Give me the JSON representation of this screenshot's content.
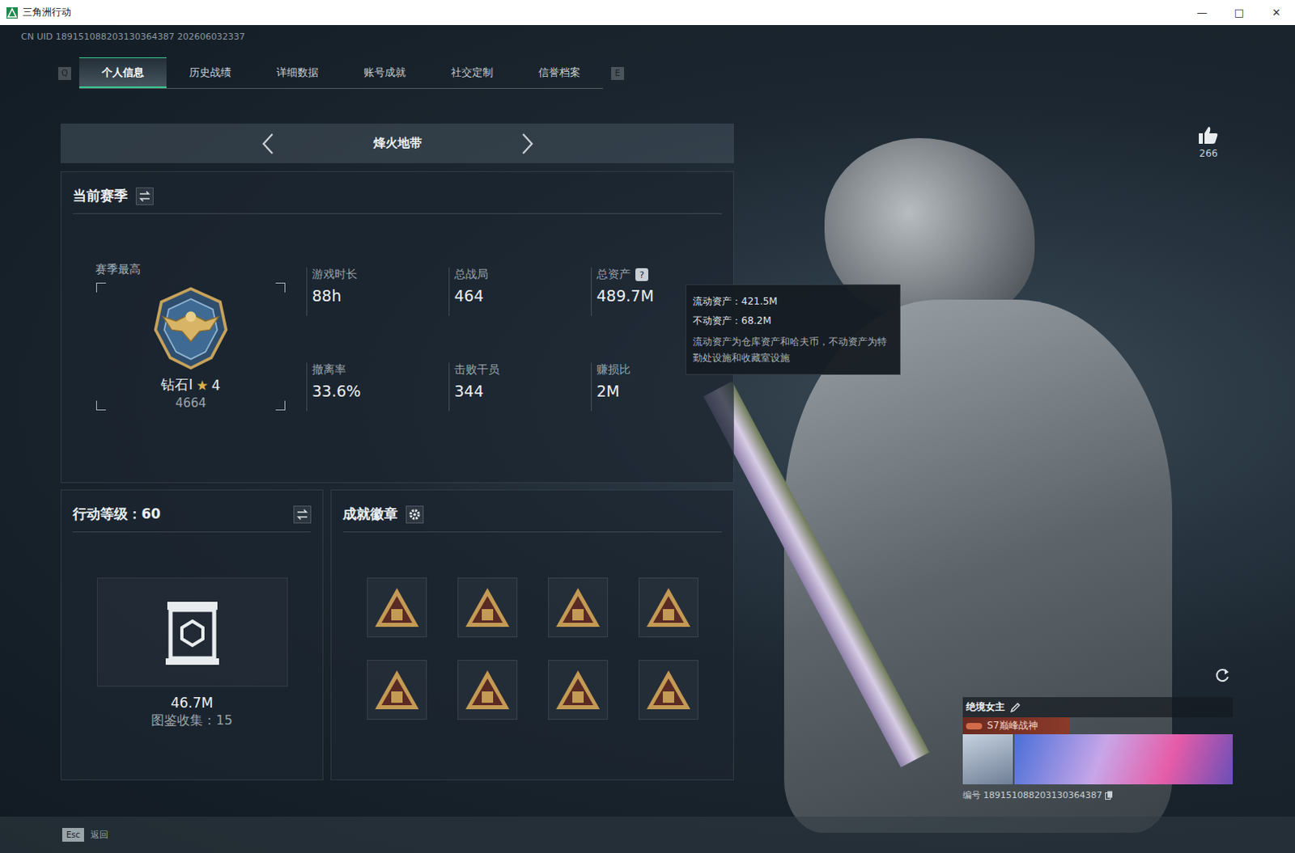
{
  "window": {
    "title": "三角洲行动",
    "controls": [
      "—",
      "□",
      "✕"
    ]
  },
  "uid": "CN UID 189151088203130364387 202606032337",
  "tabs": {
    "prev_key": "Q",
    "next_key": "E",
    "items": [
      {
        "label": "个人信息",
        "selected": true
      },
      {
        "label": "历史战绩",
        "selected": false
      },
      {
        "label": "详细数据",
        "selected": false
      },
      {
        "label": "账号成就",
        "selected": false
      },
      {
        "label": "社交定制",
        "selected": false
      },
      {
        "label": "信誉档案",
        "selected": false
      }
    ]
  },
  "mode": {
    "label": "烽火地带"
  },
  "season": {
    "title": "当前赛季",
    "best_label": "赛季最高",
    "rank": "钻石I",
    "star": "★",
    "stars": "4",
    "score": "4664",
    "stats": [
      {
        "label": "游戏时长",
        "value": "88h",
        "help": ""
      },
      {
        "label": "总战局",
        "value": "464",
        "help": ""
      },
      {
        "label": "总资产",
        "value": "489.7M",
        "help": "?"
      },
      {
        "label": "撤离率",
        "value": "33.6%",
        "help": ""
      },
      {
        "label": "击败干员",
        "value": "344",
        "help": ""
      },
      {
        "label": "赚损比",
        "value": "2M",
        "help": ""
      }
    ]
  },
  "tooltip": {
    "lines": [
      "流动资产：421.5M",
      "不动资产：68.2M"
    ],
    "note": "流动资产为仓库资产和哈夫币，不动资产为特勤处设施和收藏室设施"
  },
  "level": {
    "title": "行动等级：60",
    "value": "46.7M",
    "collection": "图鉴收集：15"
  },
  "achievements": {
    "title": "成就徽章",
    "badges": [
      {
        "earned": true
      },
      {
        "earned": true
      },
      {
        "earned": true
      },
      {
        "earned": true
      },
      {
        "earned": true
      },
      {
        "earned": true
      },
      {
        "earned": true
      },
      {
        "earned": true
      }
    ]
  },
  "like": {
    "count": "266"
  },
  "card": {
    "name": "绝境女主",
    "title": "S7巅峰战神",
    "id": "编号 189151088203130364387"
  },
  "footer": {
    "key": "Esc",
    "label": "返回"
  }
}
